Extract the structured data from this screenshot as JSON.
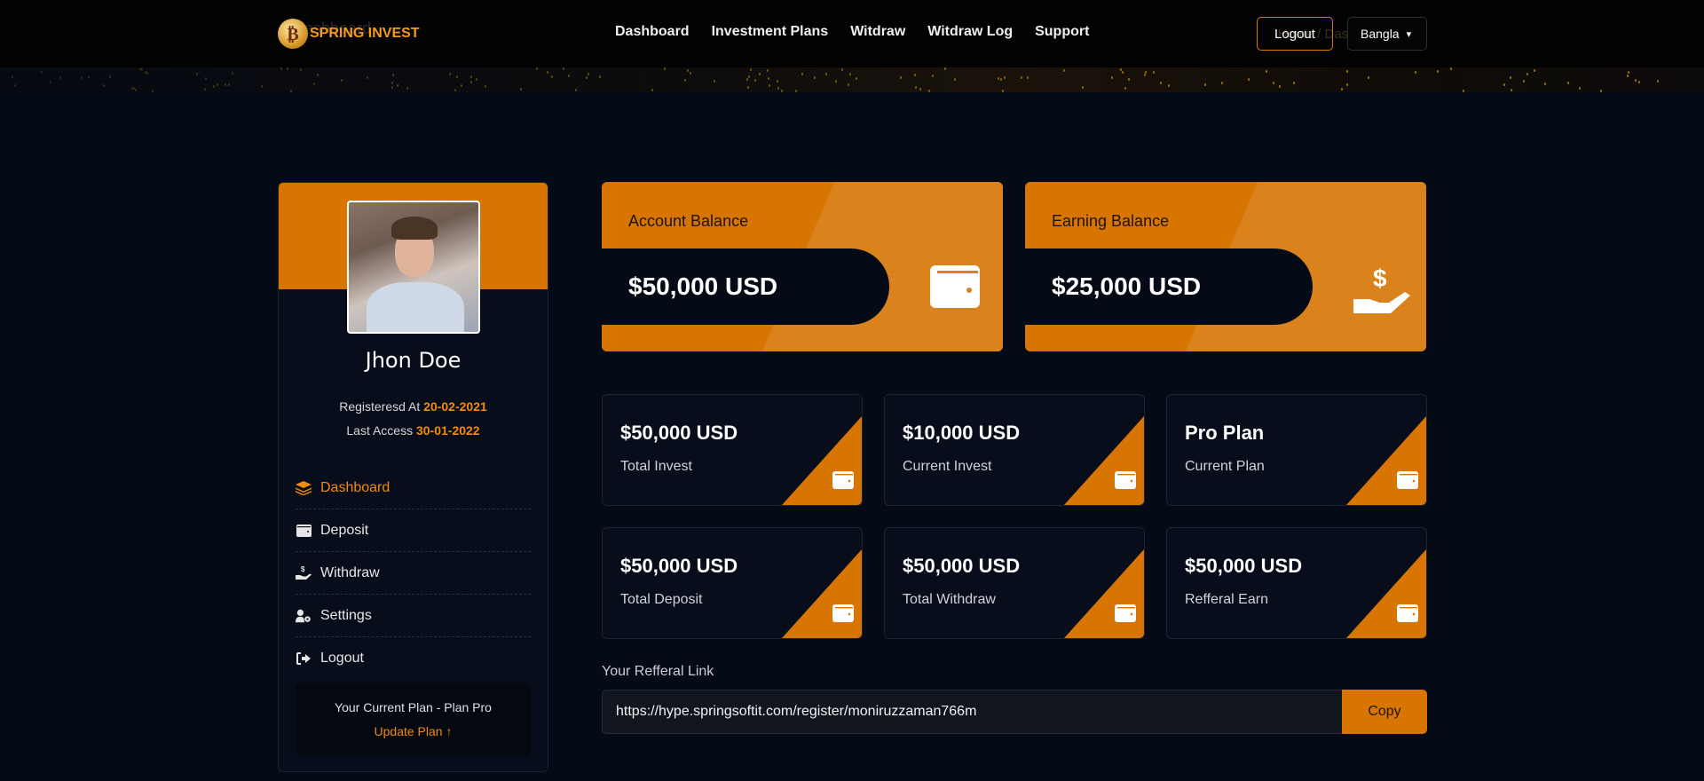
{
  "brand": {
    "logo_glyph": "₿",
    "name": "SPRING INVEST"
  },
  "breadcrumb": {
    "ghost_left": "Dashboard",
    "ghost_right": "Home  /  Dashboard"
  },
  "nav": {
    "items": [
      {
        "label": "Dashboard"
      },
      {
        "label": "Investment Plans"
      },
      {
        "label": "Witdraw"
      },
      {
        "label": "Witdraw Log"
      },
      {
        "label": "Support"
      }
    ],
    "logout_label": "Logout",
    "language": {
      "selected": "Bangla",
      "chevron": "⌄"
    }
  },
  "profile": {
    "name": "Jhon Doe",
    "registered_label": "Registeresd At",
    "registered_value": "20-02-2021",
    "last_access_label": "Last Access",
    "last_access_value": "30-01-2022",
    "menu": [
      {
        "label": "Dashboard",
        "icon": "layers-icon",
        "active": true
      },
      {
        "label": "Deposit",
        "icon": "wallet-icon",
        "active": false
      },
      {
        "label": "Withdraw",
        "icon": "hand-dollar-icon",
        "active": false
      },
      {
        "label": "Settings",
        "icon": "user-cog-icon",
        "active": false
      },
      {
        "label": "Logout",
        "icon": "sign-out-icon",
        "active": false
      }
    ],
    "plan_text": "Your Current Plan - Plan Pro",
    "update_plan_label": "Update Plan",
    "update_plan_arrow": "🡑"
  },
  "balances": [
    {
      "label": "Account Balance",
      "value": "$50,000 USD",
      "icon": "wallet-icon"
    },
    {
      "label": "Earning Balance",
      "value": "$25,000 USD",
      "icon": "hand-dollar-icon"
    }
  ],
  "stats": [
    {
      "value": "$50,000 USD",
      "label": "Total Invest"
    },
    {
      "value": "$10,000 USD",
      "label": "Current Invest"
    },
    {
      "value": "Pro Plan",
      "label": "Current Plan"
    },
    {
      "value": "$50,000 USD",
      "label": "Total Deposit"
    },
    {
      "value": "$50,000 USD",
      "label": "Total Withdraw"
    },
    {
      "value": "$50,000 USD",
      "label": "Refferal Earn"
    }
  ],
  "referral": {
    "label": "Your Refferal Link",
    "link": "https://hype.springsoftit.com/register/moniruzzaman766m",
    "copy_label": "Copy"
  },
  "colors": {
    "accent": "#d77500",
    "background": "#050b16",
    "card": "#070d1a"
  }
}
